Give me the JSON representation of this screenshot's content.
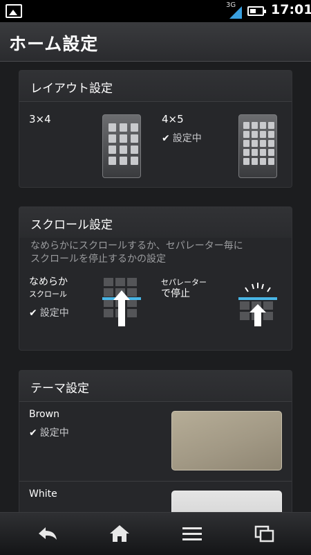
{
  "status_bar": {
    "network": "3G",
    "time": "17:01"
  },
  "title_bar": {
    "title": "ホーム設定"
  },
  "layout_card": {
    "title": "レイアウト設定",
    "options": [
      {
        "label": "3×4",
        "selected": false
      },
      {
        "label": "4×5",
        "selected": true
      }
    ],
    "selected_text": "設定中"
  },
  "scroll_card": {
    "title": "スクロール設定",
    "description_line1": "なめらかにスクロールするか、セパレーター毎に",
    "description_line2": "スクロールを停止するかの設定",
    "options": [
      {
        "label_line1": "なめらか",
        "label_line2": "スクロール",
        "selected": true
      },
      {
        "label_line1": "セパレーター",
        "label_line2": "で停止",
        "selected": false
      }
    ],
    "selected_text": "設定中"
  },
  "theme_card": {
    "title": "テーマ設定",
    "themes": [
      {
        "name": "Brown",
        "selected": true,
        "color": "#a79e88"
      },
      {
        "name": "White",
        "selected": false,
        "color": "#d9d9d9"
      }
    ],
    "selected_text": "設定中"
  },
  "nav_bar": {
    "icons": [
      "back-icon",
      "home-icon",
      "menu-icon",
      "recent-apps-icon"
    ]
  },
  "colors": {
    "accent": "#49b6e6",
    "background": "#1c1d1f",
    "card": "#26272a"
  }
}
